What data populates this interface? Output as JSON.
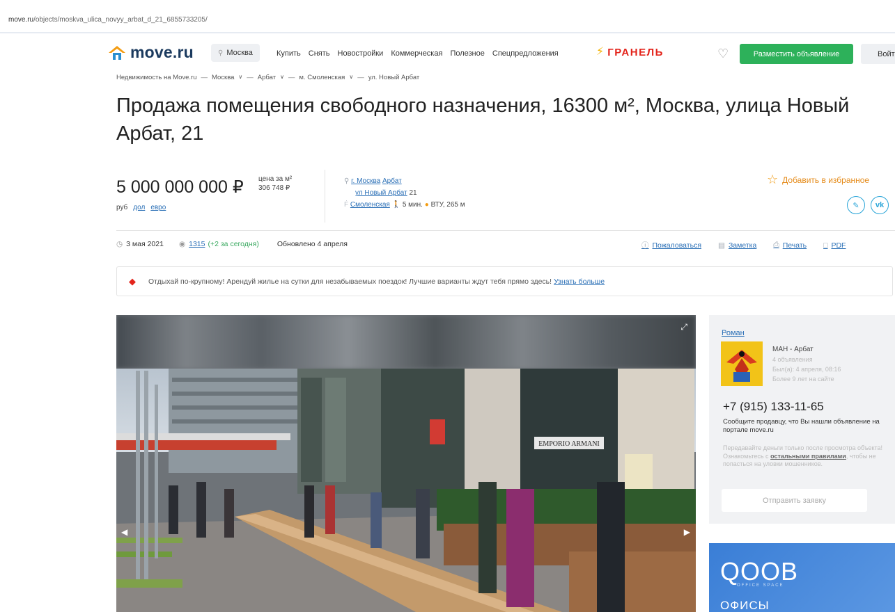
{
  "browser": {
    "url_domain": "move.ru",
    "url_path": "/objects/moskva_ulica_novyy_arbat_d_21_6855733205/"
  },
  "header": {
    "logo_text": "move.ru",
    "city": "Москва",
    "nav": [
      "Купить",
      "Снять",
      "Новостройки",
      "Коммерческая",
      "Полезное",
      "Спецпредложения"
    ],
    "promo_brand": "ГРАНЕЛЬ",
    "post_button": "Разместить объявление",
    "login_button": "Войти",
    "accent_color": "#2db15a"
  },
  "breadcrumb": [
    "Недвижимость на Move.ru",
    "Москва",
    "Арбат",
    "м. Смоленская",
    "ул. Новый Арбат"
  ],
  "listing": {
    "title": "Продажа помещения свободного назначения, 16300 м², Москва, улица Новый Арбат, 21",
    "price": "5 000 000 000 ₽",
    "price_per_m2_label": "цена за м²",
    "price_per_m2": "306 748 ₽",
    "currency_current": "руб",
    "currency_dol": "дол",
    "currency_evro": "евро",
    "address_city": "г. Москва",
    "address_district": "Арбат",
    "address_street": "ул Новый Арбат",
    "address_house": "21",
    "metro": "Смоленская",
    "metro_walk": "5 мин.",
    "poi": "ВТУ, 265 м",
    "add_favorite": "Добавить в избранное"
  },
  "meta": {
    "date": "3 мая 2021",
    "views": "1315",
    "views_today": "(+2 за сегодня)",
    "updated": "Обновлено 4 апреля",
    "complain": "Пожаловаться",
    "note": "Заметка",
    "print": "Печать",
    "pdf": "PDF"
  },
  "banner": {
    "text": "Отдыхай по-крупному! Арендуй жилье на сутки для незабываемых поездок! Лучшие варианты ждут тебя прямо здесь!",
    "link": "Узнать больше"
  },
  "seller": {
    "name": "Роман",
    "agency": "МАН - Арбат",
    "listings": "4 объявления",
    "last_seen": "Был(а): 4 апреля, 08:16",
    "tenure": "Более 9 лет на сайте",
    "phone": "+7 (915) 133-11-65",
    "note": "Сообщите продавцу, что Вы нашли объявление на портале move.ru",
    "warning_start": "Передавайте деньги только после просмотра объекта! Ознакомьтесь с",
    "warning_link": "остальными правилами",
    "warning_end": ", чтобы не попасться на уловки мошенников.",
    "send_button": "Отправить заявку"
  },
  "ad": {
    "brand": "QOOB",
    "tagline": "OFFICE SPACE",
    "subtitle": "ОФИСЫ"
  },
  "photo": {
    "storefront_sign": "EMPORIO ARMANI"
  }
}
